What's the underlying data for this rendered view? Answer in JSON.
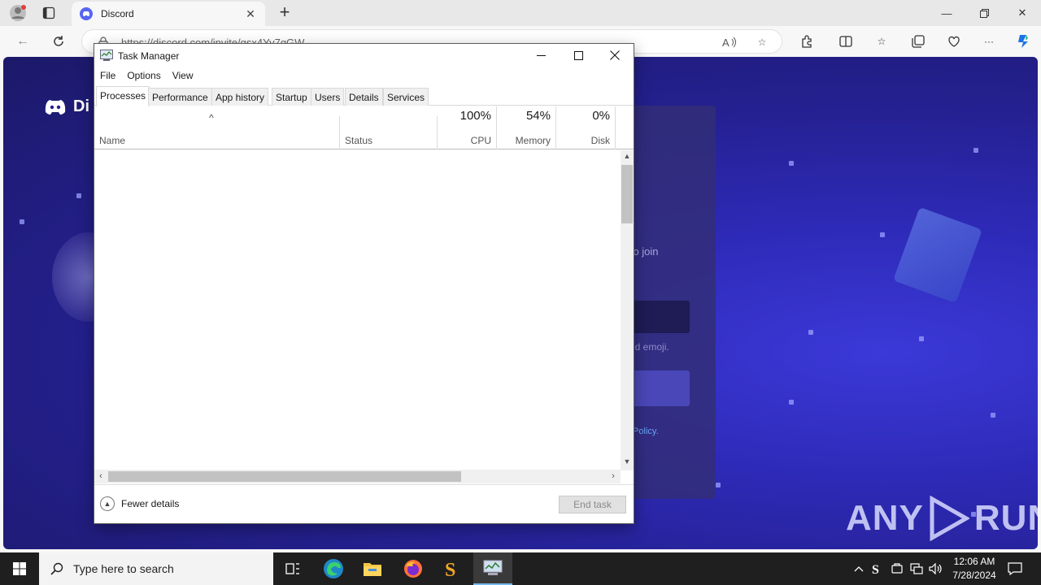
{
  "browser": {
    "tab_title": "Discord",
    "url": "https://discord.com/invite/gsx4Yv7gGW",
    "colors": {
      "discord_blurple": "#5865f2"
    }
  },
  "discord_page": {
    "logo_text": "Di",
    "text_fragment_1": "u to join",
    "text_fragment_2": "nd emoji.",
    "link_fragment": "cy Policy."
  },
  "watermark": {
    "left": "ANY",
    "right": "RUN"
  },
  "task_manager": {
    "title": "Task Manager",
    "menu": [
      "File",
      "Options",
      "View"
    ],
    "tabs": [
      "Processes",
      "Performance",
      "App history",
      "Startup",
      "Users",
      "Details",
      "Services"
    ],
    "active_tab": "Processes",
    "columns": {
      "name": "Name",
      "status": "Status",
      "cpu": {
        "value": "100%",
        "label": "CPU"
      },
      "memory": {
        "value": "54%",
        "label": "Memory"
      },
      "disk": {
        "value": "0%",
        "label": "Disk"
      }
    },
    "footer": {
      "fewer_details": "Fewer details",
      "end_task": "End task"
    }
  },
  "taskbar": {
    "search_placeholder": "Type here to search",
    "time": "12:06 AM",
    "date": "7/28/2024"
  }
}
